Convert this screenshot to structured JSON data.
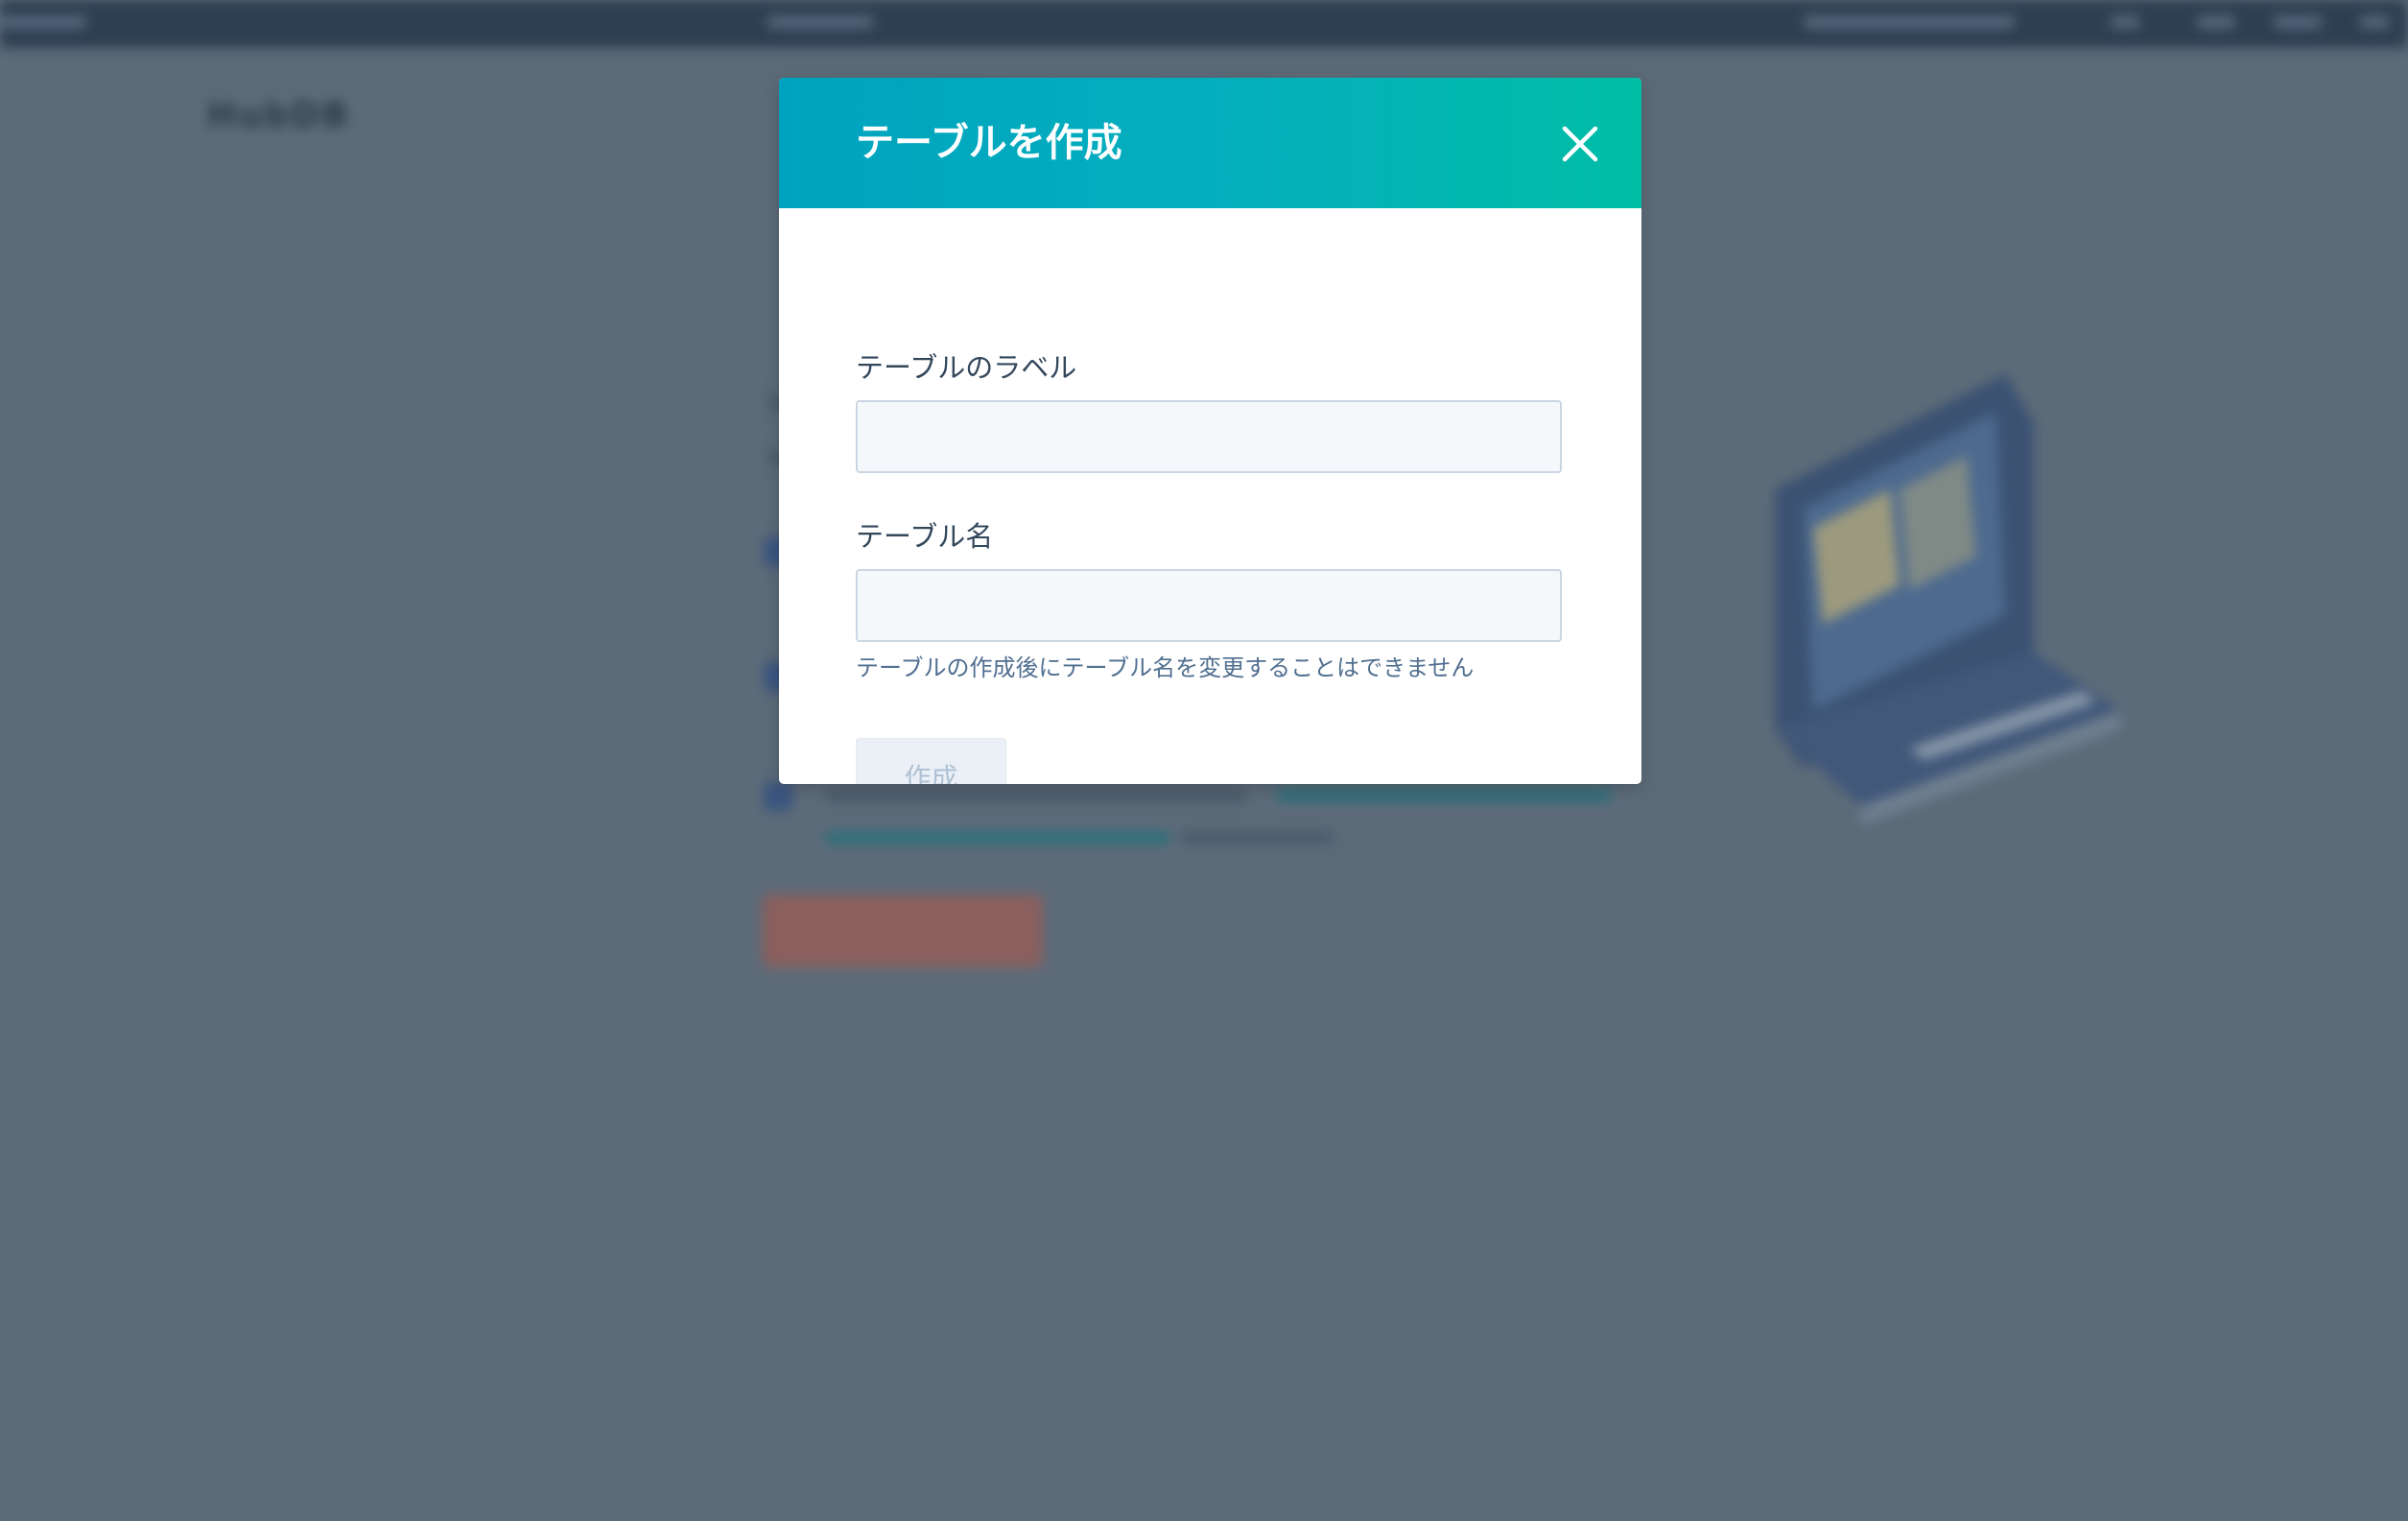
{
  "modal": {
    "title": "テーブルを作成",
    "fields": [
      {
        "label": "テーブルのラベル",
        "value": "",
        "placeholder": ""
      },
      {
        "label": "テーブル名",
        "value": "",
        "placeholder": "",
        "help_text": "テーブルの作成後にテーブル名を変更することはできません"
      }
    ],
    "create_button_label": "作成",
    "close_icon": "close-icon"
  },
  "background": {
    "heading": "HubDB",
    "primary_button_color": "#8a5f5d"
  },
  "colors": {
    "header_gradient_start": "#00a3bf",
    "header_gradient_end": "#00bda5",
    "overlay": "#5d6b79",
    "label_text": "#33475b",
    "help_text": "#516f90",
    "disabled_button_bg": "#eaf0f6",
    "disabled_button_text": "#b0c1d4"
  }
}
